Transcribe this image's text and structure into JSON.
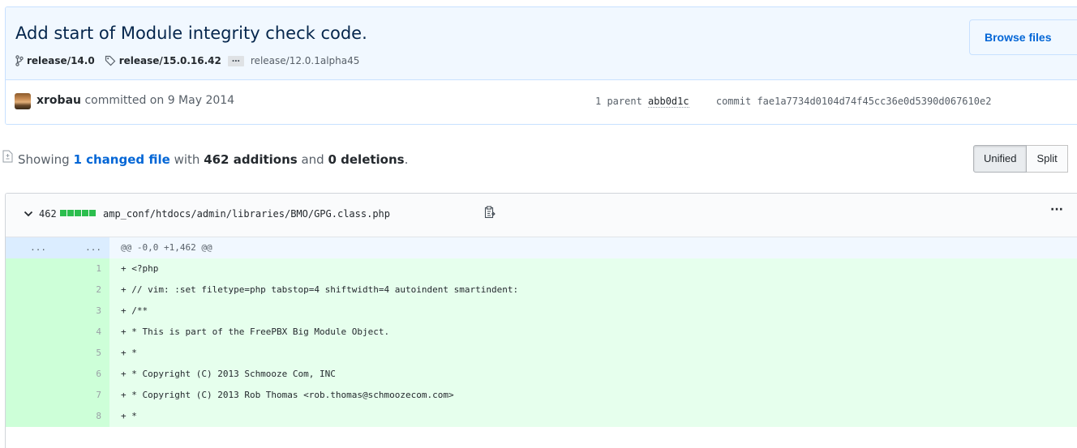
{
  "commit": {
    "title": "Add start of Module integrity check code.",
    "browse_label": "Browse files",
    "branches": [
      "release/14.0",
      "release/15.0.16.42"
    ],
    "ellipsis": "…",
    "last_tag": "release/12.0.1alpha45",
    "author": "xrobau",
    "committed_text": "committed on 9 May 2014",
    "parent_label": "1 parent",
    "parent_sha": "abb0d1c",
    "commit_label": "commit",
    "commit_sha": "fae1a7734d0104d74f45cc36e0d5390d067610e2"
  },
  "toc": {
    "prefix": "Showing",
    "changed_files": "1 changed file",
    "with": "with",
    "additions": "462 additions",
    "and": "and",
    "deletions": "0 deletions",
    "period": ".",
    "view_unified": "Unified",
    "view_split": "Split"
  },
  "file": {
    "count": "462",
    "path": "amp_conf/htdocs/admin/libraries/BMO/GPG.class.php",
    "more": "···",
    "hunk": {
      "ln1": "...",
      "ln2": "...",
      "text": "@@ -0,0 +1,462 @@"
    },
    "lines": [
      {
        "n": "1",
        "text": "+ <?php"
      },
      {
        "n": "2",
        "text": "+ // vim: :set filetype=php tabstop=4 shiftwidth=4 autoindent smartindent:"
      },
      {
        "n": "3",
        "text": "+ /**"
      },
      {
        "n": "4",
        "text": "+  * This is part of the FreePBX Big Module Object."
      },
      {
        "n": "5",
        "text": "+  *"
      },
      {
        "n": "6",
        "text": "+  * Copyright (C) 2013 Schmooze Com, INC"
      },
      {
        "n": "7",
        "text": "+  * Copyright (C) 2013 Rob Thomas <rob.thomas@schmoozecom.com>"
      },
      {
        "n": "8",
        "text": "+  *"
      }
    ]
  },
  "colors": {
    "link": "#0366d6",
    "addition": "#2cbe4e",
    "add_bg": "#e6ffed",
    "hunk_bg": "#f1f8ff"
  }
}
